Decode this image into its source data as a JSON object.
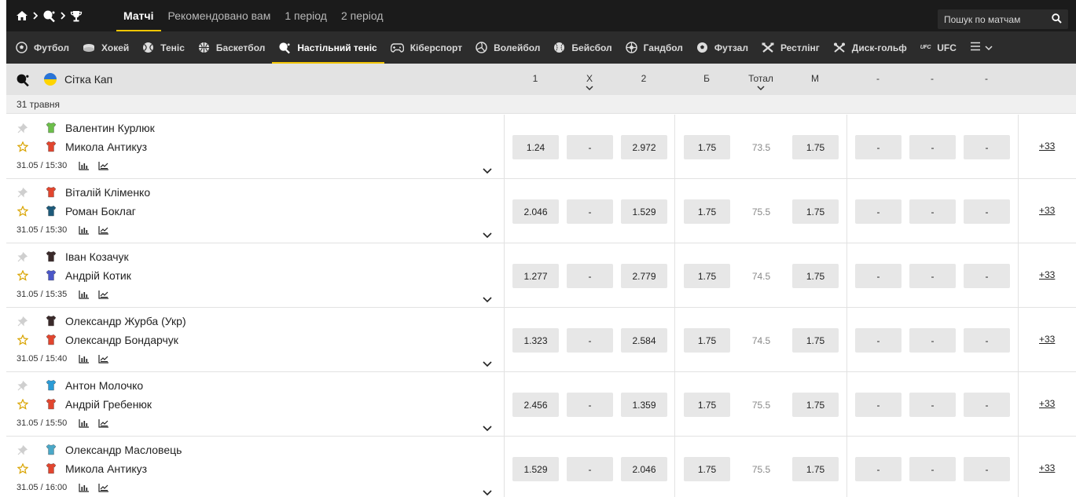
{
  "top_tabs": [
    {
      "label": "Матчі"
    },
    {
      "label": "Рекомендовано вам"
    },
    {
      "label": "1 період"
    },
    {
      "label": "2 період"
    }
  ],
  "search": {
    "placeholder": "Пошук по матчам"
  },
  "sports": [
    {
      "label": "Футбол",
      "icon": "football-icon"
    },
    {
      "label": "Хокей",
      "icon": "hockey-icon"
    },
    {
      "label": "Теніс",
      "icon": "tennis-icon"
    },
    {
      "label": "Баскетбол",
      "icon": "basketball-icon"
    },
    {
      "label": "Настільний теніс",
      "icon": "table-tennis-icon"
    },
    {
      "label": "Кіберспорт",
      "icon": "gamepad-icon"
    },
    {
      "label": "Волейбол",
      "icon": "volleyball-icon"
    },
    {
      "label": "Бейсбол",
      "icon": "baseball-icon"
    },
    {
      "label": "Гандбол",
      "icon": "handball-icon"
    },
    {
      "label": "Футзал",
      "icon": "futsal-icon"
    },
    {
      "label": "Рестлінг",
      "icon": "wrestling-icon"
    },
    {
      "label": "Диск-гольф",
      "icon": "disc-golf-icon"
    },
    {
      "label": "UFC",
      "icon": "ufc-icon",
      "mark": "UFC"
    }
  ],
  "league": {
    "name": "Сітка Кап",
    "columns": {
      "c1": "1",
      "cx": "X",
      "c2": "2",
      "b": "Б",
      "total": "Тотал",
      "m": "М",
      "e1": "-",
      "e2": "-",
      "e3": "-"
    }
  },
  "date_label": "31 травня",
  "matches": [
    {
      "p1": "Валентин Курлюк",
      "p2": "Микола Антикуз",
      "time": "31.05 / 15:30",
      "o1": "1.24",
      "ox": "-",
      "o2": "2.972",
      "b": "1.75",
      "total": "73.5",
      "m": "1.75",
      "e1": "-",
      "e2": "-",
      "e3": "-",
      "more": "+33"
    },
    {
      "p1": "Віталій Кліменко",
      "p2": "Роман Боклаг",
      "time": "31.05 / 15:30",
      "o1": "2.046",
      "ox": "-",
      "o2": "1.529",
      "b": "1.75",
      "total": "75.5",
      "m": "1.75",
      "e1": "-",
      "e2": "-",
      "e3": "-",
      "more": "+33"
    },
    {
      "p1": "Іван Козачук",
      "p2": "Андрій Котик",
      "time": "31.05 / 15:35",
      "o1": "1.277",
      "ox": "-",
      "o2": "2.779",
      "b": "1.75",
      "total": "74.5",
      "m": "1.75",
      "e1": "-",
      "e2": "-",
      "e3": "-",
      "more": "+33"
    },
    {
      "p1": "Олександр Журба (Укр)",
      "p2": "Олександр Бондарчук",
      "time": "31.05 / 15:40",
      "o1": "1.323",
      "ox": "-",
      "o2": "2.584",
      "b": "1.75",
      "total": "74.5",
      "m": "1.75",
      "e1": "-",
      "e2": "-",
      "e3": "-",
      "more": "+33"
    },
    {
      "p1": "Антон Молочко",
      "p2": "Андрій Гребенюк",
      "time": "31.05 / 15:50",
      "o1": "2.456",
      "ox": "-",
      "o2": "1.359",
      "b": "1.75",
      "total": "75.5",
      "m": "1.75",
      "e1": "-",
      "e2": "-",
      "e3": "-",
      "more": "+33"
    },
    {
      "p1": "Олександр Масловець",
      "p2": "Микола Антикуз",
      "time": "31.05 / 16:00",
      "o1": "1.529",
      "ox": "-",
      "o2": "2.046",
      "b": "1.75",
      "total": "75.5",
      "m": "1.75",
      "e1": "-",
      "e2": "-",
      "e3": "-",
      "more": "+33"
    }
  ],
  "colors": {
    "accent": "#f2c500",
    "topbar": "#1b1b1b",
    "sportsbar": "#2c2c2c",
    "odd_bg": "#e7e7e7"
  }
}
